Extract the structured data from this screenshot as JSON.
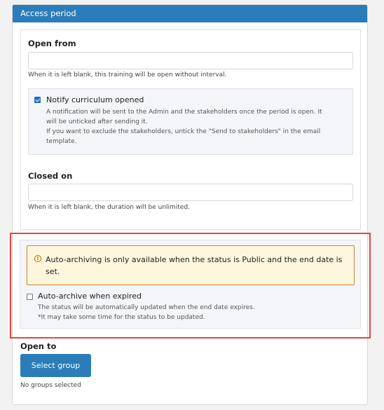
{
  "panel": {
    "title": "Access period"
  },
  "open_from": {
    "label": "Open from",
    "value": "",
    "help": "When it is left blank, this training will be open without interval."
  },
  "notify": {
    "checked": true,
    "label": "Notify curriculum opened",
    "desc_line1": "A notification will be sent to the Admin and the stakeholders once the period is open. It",
    "desc_line2": "will be unticked after sending it.",
    "desc_line3": "If you want to exclude the stakeholders, untick the \"Send to stakeholders\" in the email",
    "desc_line4": "template."
  },
  "closed_on": {
    "label": "Closed on",
    "value": "",
    "help": "When it is left blank, the duration will be unlimited."
  },
  "auto_archive": {
    "warning_line1": "Auto-archiving is only available when the status is Public and the end date is",
    "warning_line2": "set.",
    "checked": false,
    "label": "Auto-archive when expired",
    "desc_line1": "The status will be automatically updated when the end date expires.",
    "desc_line2": "*It may take some time for the status to be updated."
  },
  "open_to": {
    "label": "Open to",
    "button": "Select group",
    "status": "No groups selected"
  },
  "colors": {
    "primary": "#2a7db8",
    "highlight_border": "#e04646",
    "warning_bg": "#fdf6dc",
    "warning_border": "#c98a27",
    "checkbox_checked": "#1f6fd0"
  }
}
